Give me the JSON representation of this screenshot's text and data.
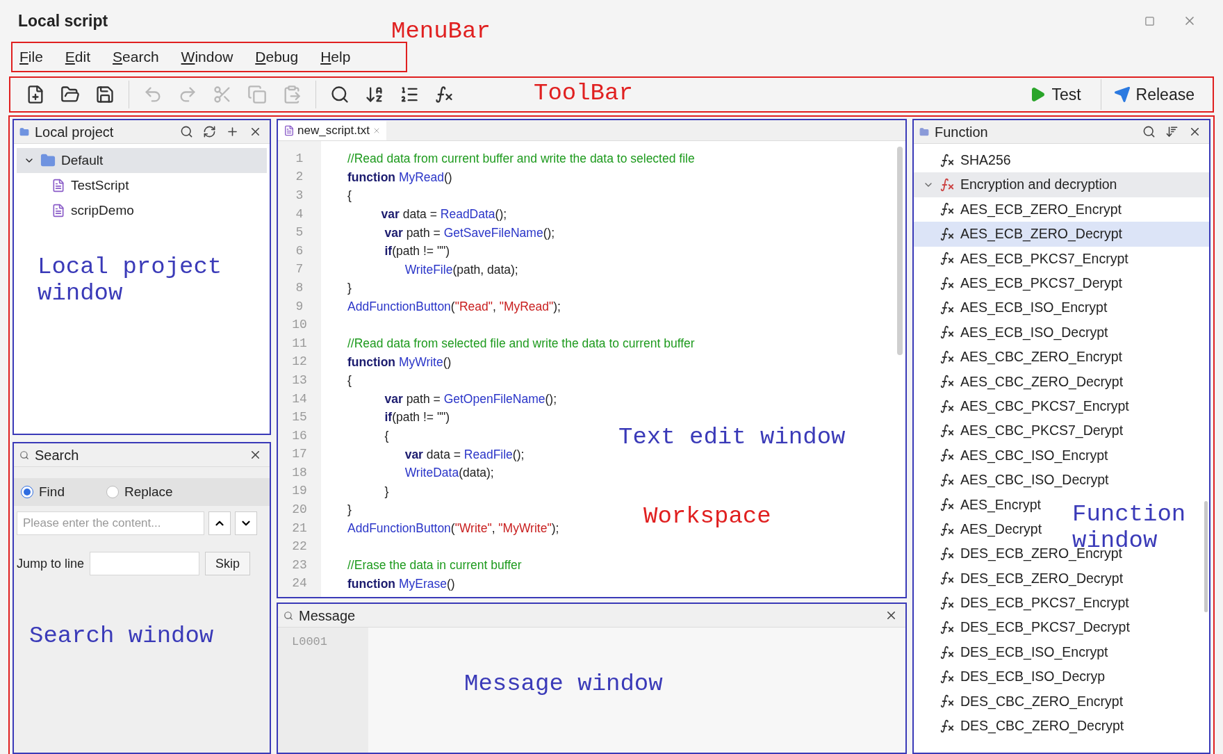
{
  "window": {
    "title": "Local script"
  },
  "menubar": {
    "annotation": {
      "text": "MenuBar",
      "color": "#e02020"
    },
    "items": [
      {
        "label": "File"
      },
      {
        "label": "Edit"
      },
      {
        "label": "Search"
      },
      {
        "label": "Window"
      },
      {
        "label": "Debug"
      },
      {
        "label": "Help"
      }
    ]
  },
  "toolbar": {
    "annotation": {
      "text": "ToolBar",
      "color": "#e02020"
    },
    "groups": [
      [
        {
          "disabled": false
        },
        {
          "disabled": false
        },
        {
          "disabled": false
        }
      ],
      [
        {
          "disabled": true
        },
        {
          "disabled": true
        },
        {
          "disabled": true
        },
        {
          "disabled": true
        },
        {
          "disabled": true
        }
      ],
      [
        {
          "disabled": false
        },
        {
          "disabled": false
        },
        {
          "disabled": false
        },
        {
          "disabled": false
        }
      ]
    ],
    "actions": [
      {
        "label": "Test"
      },
      {
        "label": "Release"
      }
    ]
  },
  "workspace": {
    "annotation": {
      "text": "Workspace",
      "color": "#e02020"
    },
    "local_project": {
      "title": "Local project",
      "annotation": {
        "text": "Local project window",
        "color": "#3a3ab8"
      },
      "tree": [
        {
          "label": "Default",
          "kind": "folder",
          "expanded": true,
          "selected": true,
          "children": [
            {
              "label": "TestScript",
              "kind": "script",
              "selected": false
            },
            {
              "label": "scripDemo",
              "kind": "script",
              "selected": false
            }
          ]
        }
      ]
    },
    "search": {
      "title": "Search",
      "annotation": {
        "text": "Search window",
        "color": "#3a3ab8"
      },
      "modes": [
        {
          "label": "Find",
          "selected": true
        },
        {
          "label": "Replace",
          "selected": false
        }
      ],
      "find_field": {
        "placeholder": "Please enter the content..."
      },
      "jump": {
        "label": "Jump to line",
        "button": "Skip"
      }
    },
    "editor": {
      "tab": {
        "label": "new_script.txt",
        "selected": true
      },
      "annotation": {
        "text": "Text edit window",
        "color": "#3a3ab8"
      },
      "lines": [
        {
          "number": "1",
          "tokens": [
            {
              "kind": "comment",
              "text": "//Read data from current buffer and write the data to selected file"
            }
          ]
        },
        {
          "number": "2",
          "tokens": [
            {
              "kind": "keyword",
              "text": "function "
            },
            {
              "kind": "func",
              "text": "MyRead"
            },
            {
              "kind": "plain",
              "text": "()"
            }
          ]
        },
        {
          "number": "3",
          "tokens": [
            {
              "kind": "plain",
              "text": "{"
            }
          ]
        },
        {
          "number": "4",
          "tokens": [
            {
              "kind": "keyword",
              "text": "          var"
            },
            {
              "kind": "plain",
              "text": " data = "
            },
            {
              "kind": "func",
              "text": "ReadData"
            },
            {
              "kind": "plain",
              "text": "();"
            }
          ]
        },
        {
          "number": "5",
          "tokens": [
            {
              "kind": "keyword",
              "text": "           var"
            },
            {
              "kind": "plain",
              "text": " path = "
            },
            {
              "kind": "func",
              "text": "GetSaveFileName"
            },
            {
              "kind": "plain",
              "text": "();"
            }
          ]
        },
        {
          "number": "6",
          "tokens": [
            {
              "kind": "keyword",
              "text": "           if"
            },
            {
              "kind": "plain",
              "text": "(path != \"\")"
            }
          ]
        },
        {
          "number": "7",
          "tokens": [
            {
              "kind": "func",
              "text": "                 WriteFile"
            },
            {
              "kind": "plain",
              "text": "(path, data);"
            }
          ]
        },
        {
          "number": "8",
          "tokens": [
            {
              "kind": "plain",
              "text": "}"
            }
          ]
        },
        {
          "number": "9",
          "tokens": [
            {
              "kind": "func",
              "text": "AddFunctionButton"
            },
            {
              "kind": "plain",
              "text": "("
            },
            {
              "kind": "string",
              "text": "\"Read\""
            },
            {
              "kind": "plain",
              "text": ", "
            },
            {
              "kind": "string",
              "text": "\"MyRead\""
            },
            {
              "kind": "plain",
              "text": ");"
            }
          ]
        },
        {
          "number": "10"
        },
        {
          "number": "11",
          "tokens": [
            {
              "kind": "comment",
              "text": "//Read data from selected file and write the data to current buffer"
            }
          ]
        },
        {
          "number": "12",
          "tokens": [
            {
              "kind": "keyword",
              "text": "function "
            },
            {
              "kind": "func",
              "text": "MyWrite"
            },
            {
              "kind": "plain",
              "text": "()"
            }
          ]
        },
        {
          "number": "13",
          "tokens": [
            {
              "kind": "plain",
              "text": "{"
            }
          ]
        },
        {
          "number": "14",
          "tokens": [
            {
              "kind": "keyword",
              "text": "           var"
            },
            {
              "kind": "plain",
              "text": " path = "
            },
            {
              "kind": "func",
              "text": "GetOpenFileName"
            },
            {
              "kind": "plain",
              "text": "();"
            }
          ]
        },
        {
          "number": "15",
          "tokens": [
            {
              "kind": "keyword",
              "text": "           if"
            },
            {
              "kind": "plain",
              "text": "(path != \"\")"
            }
          ]
        },
        {
          "number": "16",
          "tokens": [
            {
              "kind": "plain",
              "text": "           {"
            }
          ]
        },
        {
          "number": "17",
          "tokens": [
            {
              "kind": "keyword",
              "text": "                 var"
            },
            {
              "kind": "plain",
              "text": " data = "
            },
            {
              "kind": "func",
              "text": "ReadFile"
            },
            {
              "kind": "plain",
              "text": "();"
            }
          ]
        },
        {
          "number": "18",
          "tokens": [
            {
              "kind": "func",
              "text": "                 WriteData"
            },
            {
              "kind": "plain",
              "text": "(data);"
            }
          ]
        },
        {
          "number": "19",
          "tokens": [
            {
              "kind": "plain",
              "text": "           }"
            }
          ]
        },
        {
          "number": "20",
          "tokens": [
            {
              "kind": "plain",
              "text": "}"
            }
          ]
        },
        {
          "number": "21",
          "tokens": [
            {
              "kind": "func",
              "text": "AddFunctionButton"
            },
            {
              "kind": "plain",
              "text": "("
            },
            {
              "kind": "string",
              "text": "\"Write\""
            },
            {
              "kind": "plain",
              "text": ", "
            },
            {
              "kind": "string",
              "text": "\"MyWrite\""
            },
            {
              "kind": "plain",
              "text": ");"
            }
          ]
        },
        {
          "number": "22"
        },
        {
          "number": "23",
          "tokens": [
            {
              "kind": "comment",
              "text": "//Erase the data in current buffer"
            }
          ]
        },
        {
          "number": "24",
          "tokens": [
            {
              "kind": "keyword",
              "text": "function "
            },
            {
              "kind": "func",
              "text": "MyErase"
            },
            {
              "kind": "plain",
              "text": "()"
            }
          ]
        }
      ]
    },
    "message": {
      "title": "Message",
      "annotation": {
        "text": "Message window",
        "color": "#3a3ab8"
      },
      "lines": [
        "L0001"
      ]
    },
    "function": {
      "title": "Function",
      "annotation": {
        "text": "Function window",
        "color": "#3a3ab8"
      },
      "items": [
        {
          "label": "SHA256",
          "kind": "function",
          "selected": false
        },
        {
          "label": "Encryption and decryption",
          "kind": "group",
          "expanded": true,
          "selected": false,
          "children": [
            {
              "label": "AES_ECB_ZERO_Encrypt",
              "kind": "function",
              "selected": false
            },
            {
              "label": "AES_ECB_ZERO_Decrypt",
              "kind": "function",
              "selected": true
            },
            {
              "label": "AES_ECB_PKCS7_Encrypt",
              "kind": "function",
              "selected": false
            },
            {
              "label": "AES_ECB_PKCS7_Derypt",
              "kind": "function",
              "selected": false
            },
            {
              "label": "AES_ECB_ISO_Encrypt",
              "kind": "function",
              "selected": false
            },
            {
              "label": "AES_ECB_ISO_Decrypt",
              "kind": "function",
              "selected": false
            },
            {
              "label": "AES_CBC_ZERO_Encrypt",
              "kind": "function",
              "selected": false
            },
            {
              "label": "AES_CBC_ZERO_Decrypt",
              "kind": "function",
              "selected": false
            },
            {
              "label": "AES_CBC_PKCS7_Encrypt",
              "kind": "function",
              "selected": false
            },
            {
              "label": "AES_CBC_PKCS7_Derypt",
              "kind": "function",
              "selected": false
            },
            {
              "label": "AES_CBC_ISO_Encrypt",
              "kind": "function",
              "selected": false
            },
            {
              "label": "AES_CBC_ISO_Decrypt",
              "kind": "function",
              "selected": false
            },
            {
              "label": "AES_Encrypt",
              "kind": "function",
              "selected": false
            },
            {
              "label": "AES_Decrypt",
              "kind": "function",
              "selected": false
            },
            {
              "label": "DES_ECB_ZERO_Encrypt",
              "kind": "function",
              "selected": false
            },
            {
              "label": "DES_ECB_ZERO_Decrypt",
              "kind": "function",
              "selected": false
            },
            {
              "label": "DES_ECB_PKCS7_Encrypt",
              "kind": "function",
              "selected": false
            },
            {
              "label": "DES_ECB_PKCS7_Decrypt",
              "kind": "function",
              "selected": false
            },
            {
              "label": "DES_ECB_ISO_Encrypt",
              "kind": "function",
              "selected": false
            },
            {
              "label": "DES_ECB_ISO_Decryp",
              "kind": "function",
              "selected": false
            },
            {
              "label": "DES_CBC_ZERO_Encrypt",
              "kind": "function",
              "selected": false
            },
            {
              "label": "DES_CBC_ZERO_Decrypt",
              "kind": "function",
              "selected": false
            }
          ]
        }
      ]
    }
  }
}
